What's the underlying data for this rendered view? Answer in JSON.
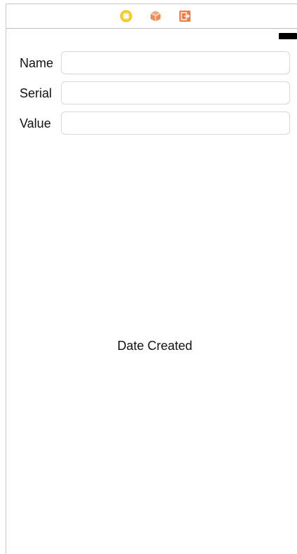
{
  "toolbar": {
    "icons": [
      "view-controller-icon",
      "first-responder-icon",
      "exit-icon"
    ],
    "colors": {
      "view_controller": "#f5c20f",
      "first_responder": "#f08a50",
      "exit": "#f07e4a"
    }
  },
  "status_bar": {
    "battery": "battery-icon"
  },
  "form": {
    "name_label": "Name",
    "name_value": "",
    "serial_label": "Serial",
    "serial_value": "",
    "value_label": "Value",
    "value_value": ""
  },
  "date_label": "Date Created"
}
